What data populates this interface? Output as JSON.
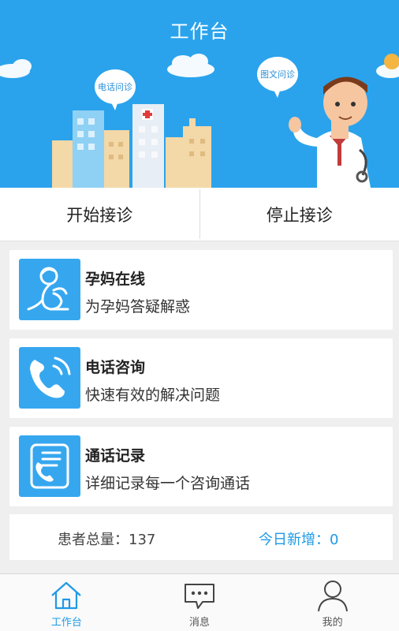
{
  "header": {
    "title": "工作台"
  },
  "banner": {
    "bubble_phone": "电话问诊",
    "bubble_text": "图文问诊"
  },
  "actions": {
    "start_label": "开始接诊",
    "stop_label": "停止接诊"
  },
  "cards": [
    {
      "title": "孕妈在线",
      "subtitle": "为孕妈答疑解惑",
      "icon": "pregnant-woman-icon"
    },
    {
      "title": "电话咨询",
      "subtitle": "快速有效的解决问题",
      "icon": "phone-call-icon"
    },
    {
      "title": "通话记录",
      "subtitle": "详细记录每一个咨询通话",
      "icon": "call-log-icon"
    }
  ],
  "stats": {
    "total_label": "患者总量：137",
    "today_label": "今日新增：0"
  },
  "nav": [
    {
      "label": "工作台",
      "icon": "home-icon",
      "active": true
    },
    {
      "label": "消息",
      "icon": "message-icon",
      "active": false
    },
    {
      "label": "我的",
      "icon": "user-icon",
      "active": false
    }
  ],
  "colors": {
    "primary": "#2aa3ec",
    "icon_bg": "#36a7ef",
    "accent_text": "#1e9ae6",
    "background": "#efefef"
  }
}
